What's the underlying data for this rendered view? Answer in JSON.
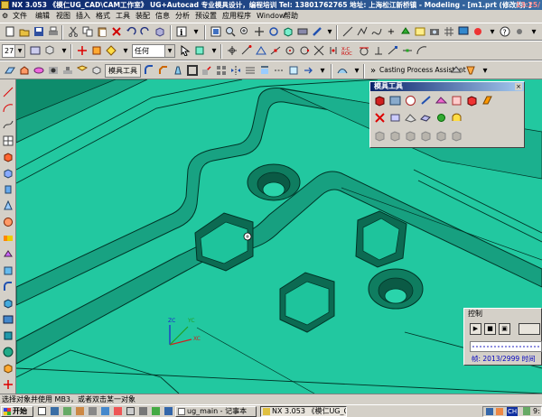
{
  "titlebar": {
    "text": "NX 3.053 《模仁UG_CAD\\CAM工作室》 UG+Autocad 专业模具设计，编程培训 Tel: 13801762765 地址: 上海松江新桥镇 - Modeling - [m1.prt (修改的) ]",
    "clock": "13:25/"
  },
  "menubar": {
    "items": [
      "文件",
      "编辑",
      "视图",
      "插入",
      "格式",
      "工具",
      "装配",
      "信息",
      "分析",
      "预设置",
      "应用程序",
      "Window",
      "帮助"
    ]
  },
  "toolbar3": {
    "layer_value": "27",
    "filter_value": "任何",
    "mold_tools_label": "模具工具",
    "casting_label": "Casting Process Assistant"
  },
  "mold_tools_panel": {
    "title": "模具工具",
    "close": "×"
  },
  "control_panel": {
    "title": "控制",
    "frame_text": "帧: 2013/2999 时间"
  },
  "statusbar": {
    "text": "选择对象并使用 MB3，或者双击某一对象"
  },
  "taskbar": {
    "start": "开始",
    "tasks": [
      {
        "label": "ug_main - 记事本"
      },
      {
        "label": "NX 3.053 《模仁UG_CA..."
      }
    ],
    "tray_text": "CH",
    "tray_clock": "9:"
  },
  "wcs": {
    "zc": "ZC",
    "yc": "YC",
    "xc": "XC"
  },
  "colors": {
    "model": "#22c8a0",
    "model_dark": "#0e7a5e",
    "edge": "#003326",
    "title_gradient": "#0a246a"
  }
}
